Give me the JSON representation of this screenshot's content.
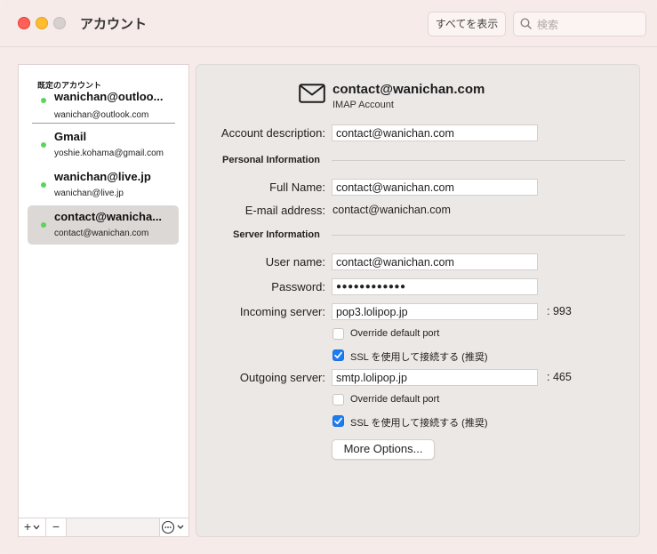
{
  "window": {
    "title": "アカウント",
    "show_all_label": "すべてを表示",
    "search_placeholder": "検索"
  },
  "sidebar": {
    "section_label": "既定のアカウント",
    "accounts": [
      {
        "name": "wanichan@outloo...",
        "email": "wanichan@outlook.com",
        "status_color": "#5bd45b"
      },
      {
        "name": "Gmail",
        "email": "yoshie.kohama@gmail.com",
        "status_color": "#5bd45b"
      },
      {
        "name": "wanichan@live.jp",
        "email": "wanichan@live.jp",
        "status_color": "#5bd45b"
      },
      {
        "name": "contact@wanicha...",
        "email": "contact@wanichan.com",
        "status_color": "#5bd45b",
        "selected": true
      }
    ],
    "toolbar": {
      "add": "+",
      "remove": "−"
    }
  },
  "account": {
    "header_email": "contact@wanichan.com",
    "header_type": "IMAP Account",
    "description_label": "Account description:",
    "description_value": "contact@wanichan.com",
    "personal_section": "Personal Information",
    "full_name_label": "Full Name:",
    "full_name_value": "contact@wanichan.com",
    "email_label": "E-mail address:",
    "email_value": "contact@wanichan.com",
    "server_section": "Server Information",
    "username_label": "User name:",
    "username_value": "contact@wanichan.com",
    "password_label": "Password:",
    "password_value": "●●●●●●●●●●●●",
    "incoming_label": "Incoming server:",
    "incoming_value": "pop3.lolipop.jp",
    "incoming_port": ": 993",
    "incoming_override_label": "Override default port",
    "incoming_override_checked": false,
    "incoming_ssl_label": "SSL を使用して接続する (推奨)",
    "incoming_ssl_checked": true,
    "outgoing_label": "Outgoing server:",
    "outgoing_value": "smtp.lolipop.jp",
    "outgoing_port": ": 465",
    "outgoing_override_label": "Override default port",
    "outgoing_override_checked": false,
    "outgoing_ssl_label": "SSL を使用して接続する (推奨)",
    "outgoing_ssl_checked": true,
    "more_options_label": "More Options..."
  },
  "colors": {
    "accent": "#1c7cf4",
    "status_online": "#5bd45b",
    "close": "#fe5f57",
    "minimize": "#febc2e"
  }
}
